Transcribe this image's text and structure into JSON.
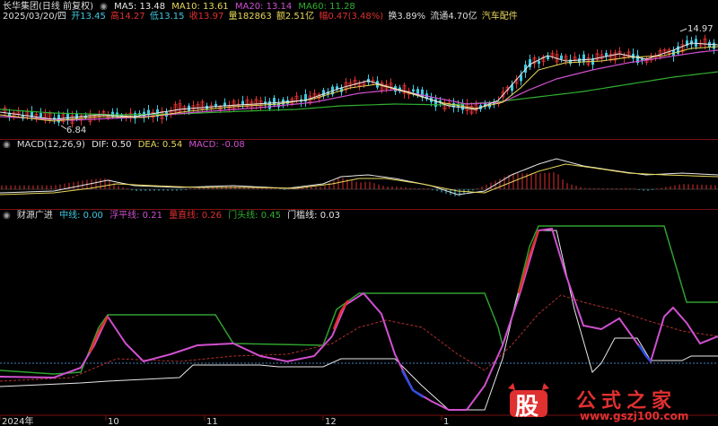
{
  "header": {
    "stock_name": "长华集团(日线 前复权)",
    "ma5": "MA5: 13.48",
    "ma10": "MA10: 13.61",
    "ma20": "MA20: 13.14",
    "ma60": "MA60: 11.28",
    "date": "2025/03/20/四",
    "open": "开13.45",
    "high": "高14.27",
    "low": "低13.15",
    "close": "收13.97",
    "volume": "量182863",
    "amount": "额2.51亿",
    "amplitude": "幅0.47(3.48%)",
    "turnover": "换3.89%",
    "float_cap": "流通4.70亿",
    "sector": "汽车配件"
  },
  "price_panel": {
    "high_label": "14.97",
    "low_label": "6.84"
  },
  "macd": {
    "title": "MACD(12,26,9)",
    "dif": "DIF: 0.50",
    "dea": "DEA: 0.54",
    "macd": "MACD: -0.08"
  },
  "indicator": {
    "title": "财源广进",
    "zx": "中线: 0.00",
    "fpx": "浮平线: 0.21",
    "lcx": "量直线: 0.26",
    "mtx": "门头线: 0.45",
    "mkx": "门槛线: 0.03"
  },
  "xaxis": {
    "labels": [
      "2024年",
      "10",
      "11",
      "12",
      "1"
    ]
  },
  "watermark": {
    "logo": "股",
    "title": "公式之家",
    "url": "www.gszj100.com"
  },
  "colors": {
    "white": "#e8e8e8",
    "yellow": "#e8d85a",
    "magenta": "#d050d0",
    "green": "#30b030",
    "cyan": "#40c8e0",
    "red": "#e03030",
    "dark_red": "#a03030",
    "blue": "#3050e0"
  }
}
